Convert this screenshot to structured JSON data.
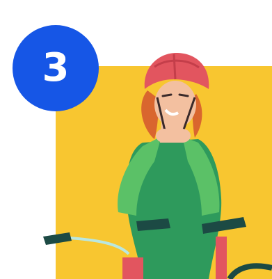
{
  "badge": {
    "number": "3",
    "color": "#1656e6",
    "text_color": "#ffffff"
  },
  "scene": {
    "panel_color": "#f8c630",
    "icon": "cyclist-putting-on-helmet-illustration",
    "colors": {
      "helmet": "#e2555f",
      "hair": "#d9662e",
      "skin": "#f3c0a0",
      "jersey": "#2e9a5c",
      "sleeve": "#5bc167",
      "bike_frame": "#e2555f",
      "handlebar": "#1c4a44",
      "cable": "#b9e7e0"
    }
  }
}
